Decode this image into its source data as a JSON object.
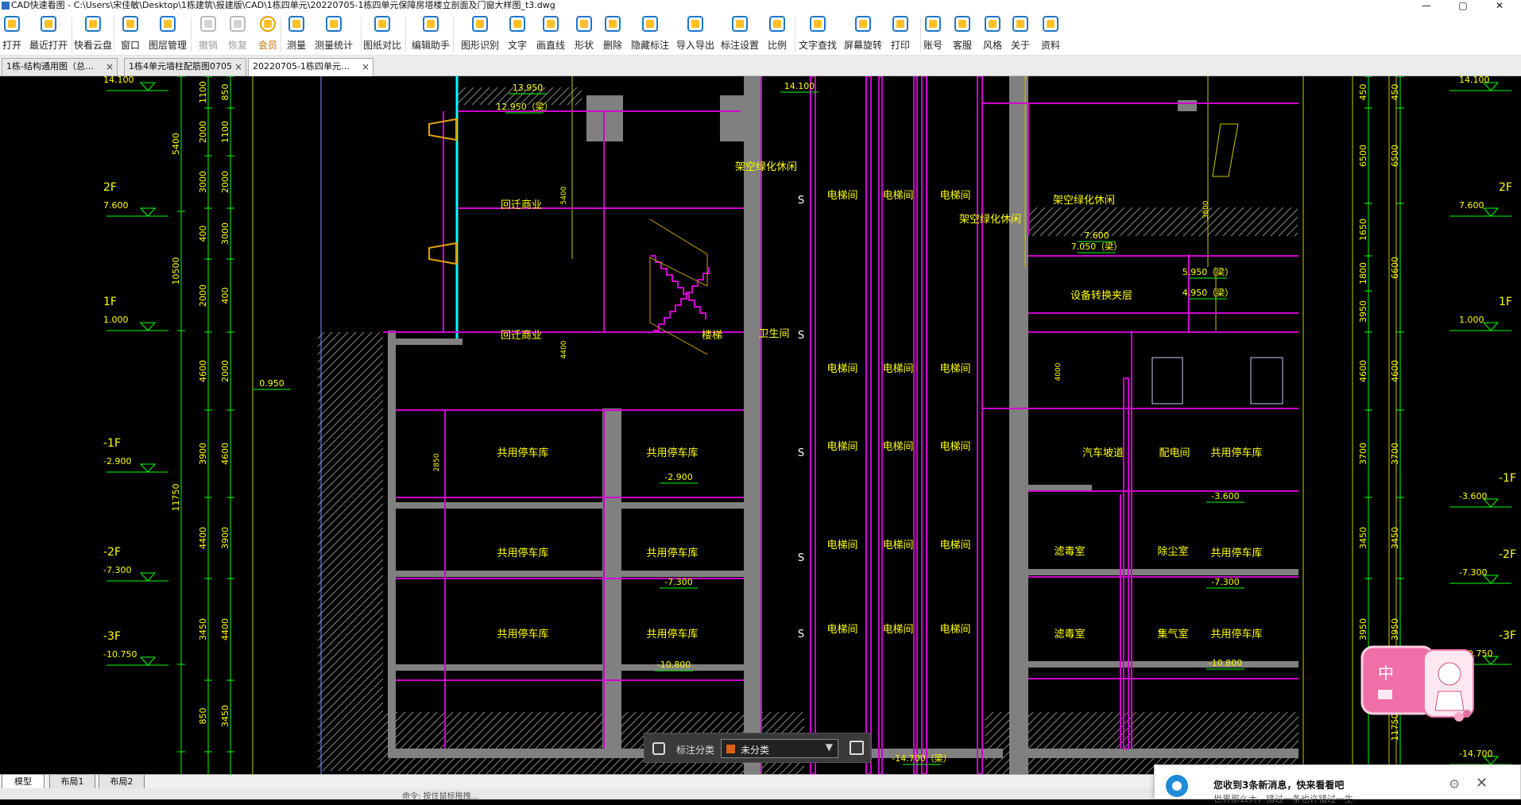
{
  "window": {
    "title": "CAD快速看图 - C:\\Users\\宋佳敏\\Desktop\\1栋建筑\\报建版\\CAD\\1栋四单元\\20220705-1栋四单元保障房塔楼立剖面及门窗大样图_t3.dwg",
    "controls": [
      "—",
      "▢",
      "✕"
    ]
  },
  "toolbar": [
    "打开",
    "最近打开",
    "快看云盘",
    "窗口",
    "图层管理",
    "撤销",
    "恢复",
    "会员",
    "测量",
    "测量统计",
    "图纸对比",
    "编辑助手",
    "图形识别",
    "文字",
    "画直线",
    "形状",
    "删除",
    "隐藏标注",
    "导入导出",
    "标注设置",
    "比例",
    "文字查找",
    "屏幕旋转",
    "打印",
    "账号",
    "客服",
    "风格",
    "关于",
    "资料"
  ],
  "tabs": [
    {
      "label": "1栋-结构通用图（总…",
      "close": "×"
    },
    {
      "label": "1栋4单元墙柱配筋图0705",
      "close": "×"
    },
    {
      "label": "20220705-1栋四单元…",
      "close": "×"
    }
  ],
  "drawing": {
    "floors_left": [
      {
        "name": "",
        "elev": "14.100"
      },
      {
        "name": "2F",
        "elev": "7.600"
      },
      {
        "name": "1F",
        "elev": "1.000"
      },
      {
        "name": "-1F",
        "elev": "-2.900"
      },
      {
        "name": "-2F",
        "elev": "-7.300"
      },
      {
        "name": "-3F",
        "elev": "-10.750"
      }
    ],
    "floors_right": [
      {
        "name": "",
        "elev": "14.100"
      },
      {
        "name": "2F",
        "elev": "7.600"
      },
      {
        "name": "1F",
        "elev": "1.000"
      },
      {
        "name": "-1F",
        "elev": "-3.600"
      },
      {
        "name": "-2F",
        "elev": "-7.300"
      },
      {
        "name": "-3F",
        "elev": "-10.750"
      },
      {
        "name": "",
        "elev": "-14.700"
      }
    ],
    "dims_left_outer": [
      "5400",
      "10500",
      "11750"
    ],
    "dims_left_mid": [
      "1100",
      "2000",
      "3000",
      "400",
      "2000",
      "4600",
      "3900",
      "4400",
      "3450",
      "850"
    ],
    "dims_left_inner": [
      "850",
      "1100",
      "2000",
      "3000",
      "400",
      "2000",
      "4600",
      "3900",
      "4400",
      "3450"
    ],
    "dims_right_a": [
      "450",
      "6500",
      "1650",
      "1800",
      "3950",
      "4600",
      "3700",
      "3450",
      "3950"
    ],
    "dims_right_b": [
      "450",
      "6500",
      "6600",
      "4600",
      "3700",
      "3450",
      "3950",
      "11750"
    ],
    "inner_dims": [
      "5400",
      "4400",
      "2850",
      "4000",
      "3800"
    ],
    "elev_labels": [
      "13.950",
      "12.950（梁）",
      "0.950",
      "-2.900",
      "-7.300",
      "-10.800",
      "7.600",
      "7.050（梁）",
      "5.950（梁）",
      "4.950（梁）",
      "-3.600",
      "-7.300",
      "-10.800",
      "-14.700（梁）",
      "14.100"
    ],
    "rooms": [
      "回迁商业",
      "回迁商业",
      "架空绿化休闲",
      "楼梯",
      "卫生间",
      "电梯间",
      "电梯间",
      "电梯间",
      "电梯间",
      "电梯间",
      "电梯间",
      "电梯间",
      "电梯间",
      "电梯间",
      "电梯间",
      "电梯间",
      "电梯间",
      "电梯间",
      "电梯间",
      "电梯间",
      "架空绿化休闲",
      "架空绿化休闲",
      "设备转换夹层",
      "汽车坡道",
      "配电间",
      "共用停车库",
      "共用停车库",
      "共用停车库",
      "共用停车库",
      "共用停车库",
      "共用停车库",
      "共用停车库",
      "共用停车库",
      "共用停车库",
      "滤毒室",
      "除尘室",
      "滤毒室",
      "集气室",
      "S",
      "S",
      "S",
      "S",
      "S"
    ]
  },
  "annotation_panel": {
    "label": "标注分类",
    "value": "未分类"
  },
  "layout_tabs": [
    "模型",
    "布局1",
    "布局2"
  ],
  "status_text": "命令: 按住鼠标拖拽...",
  "sticker_text": "中",
  "notification": {
    "title": "您收到3条新消息，快来看看吧",
    "sub": "世界那么大，错过一条也许错过一生"
  },
  "colors": {
    "floor_line": "#d000d0",
    "wall_fill": "#808080",
    "text": "#ffff00",
    "dim": "#00ff00",
    "column": "#00ffff",
    "sel": "#e06010"
  }
}
